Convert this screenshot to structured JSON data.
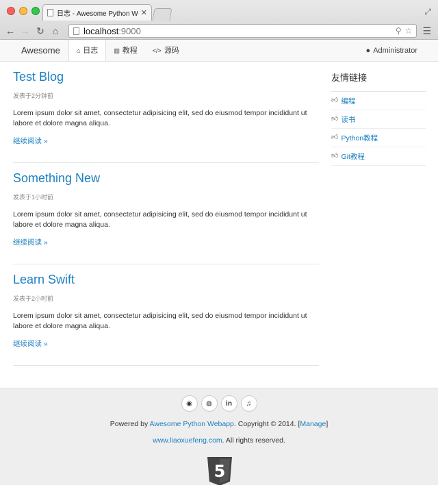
{
  "browser": {
    "tab_title": "日志 - Awesome Python Webapp",
    "url_host": "localhost",
    "url_port": ":9000"
  },
  "navbar": {
    "brand": "Awesome",
    "items": [
      {
        "label": "日志",
        "icon": "home-icon"
      },
      {
        "label": "教程",
        "icon": "book-icon"
      },
      {
        "label": "源码",
        "icon": "code-icon"
      }
    ],
    "user": "Administrator"
  },
  "articles": [
    {
      "title": "Test Blog",
      "meta": "发表于2分钟前",
      "body": "Lorem ipsum dolor sit amet, consectetur adipisicing elit, sed do eiusmod tempor incididunt ut labore et dolore magna aliqua.",
      "more": "继续阅读 »"
    },
    {
      "title": "Something New",
      "meta": "发表于1小时前",
      "body": "Lorem ipsum dolor sit amet, consectetur adipisicing elit, sed do eiusmod tempor incididunt ut labore et dolore magna aliqua.",
      "more": "继续阅读 »"
    },
    {
      "title": "Learn Swift",
      "meta": "发表于2小时前",
      "body": "Lorem ipsum dolor sit amet, consectetur adipisicing elit, sed do eiusmod tempor incididunt ut labore et dolore magna aliqua.",
      "more": "继续阅读 »"
    }
  ],
  "sidebar": {
    "heading": "友情链接",
    "links": [
      "编程",
      "读书",
      "Python教程",
      "Git教程"
    ]
  },
  "footer": {
    "social": [
      "weibo-icon",
      "github-icon",
      "linkedin-icon",
      "twitter-icon"
    ],
    "powered_prefix": "Powered by ",
    "powered_link": "Awesome Python Webapp",
    "powered_mid": ". Copyright © 2014. [",
    "manage": "Manage",
    "powered_suffix": "]",
    "site_link": "www.liaoxuefeng.com",
    "site_suffix": ". All rights reserved.",
    "html5_label": "5"
  },
  "colors": {
    "link": "#1a7fc1",
    "footer_bg": "#eeeeee",
    "navbar_bg": "#f8f8f8"
  }
}
